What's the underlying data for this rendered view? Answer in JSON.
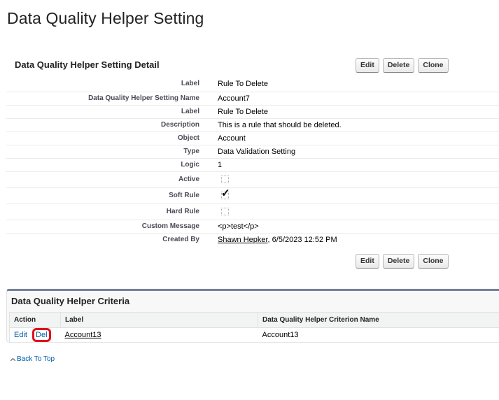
{
  "page": {
    "title": "Data Quality Helper Setting"
  },
  "detail": {
    "header": "Data Quality Helper Setting Detail",
    "buttons": {
      "edit": "Edit",
      "delete": "Delete",
      "clone": "Clone"
    },
    "fields": [
      {
        "label": "Label",
        "value": "Rule To Delete"
      },
      {
        "label": "Data Quality Helper Setting Name",
        "value": "Account7"
      },
      {
        "label": "Label",
        "value": "Rule To Delete"
      },
      {
        "label": "Description",
        "value": "This is a rule that should be deleted."
      },
      {
        "label": "Object",
        "value": "Account"
      },
      {
        "label": "Type",
        "value": "Data Validation Setting"
      },
      {
        "label": "Logic",
        "value": "1"
      },
      {
        "label": "Active",
        "checked": false
      },
      {
        "label": "Soft Rule",
        "checked": true
      },
      {
        "label": "Hard Rule",
        "checked": false
      },
      {
        "label": "Custom Message",
        "value": "<p>test</p>"
      },
      {
        "label": "Created By",
        "user": "Shawn Hepker",
        "timestamp": ", 6/5/2023 12:52 PM"
      }
    ],
    "checkmark_glyph": "✓"
  },
  "criteria": {
    "title": "Data Quality Helper Criteria",
    "columns": [
      "Action",
      "Label",
      "Data Quality Helper Criterion Name"
    ],
    "rows": [
      {
        "edit": "Edit",
        "del": "Del",
        "label": "Account13",
        "name": "Account13"
      }
    ],
    "highlight_color": "#e0101b"
  },
  "footer": {
    "back_to_top": "Back To Top"
  },
  "colors": {
    "link": "#015ba7",
    "panel_border": "#747e96"
  }
}
